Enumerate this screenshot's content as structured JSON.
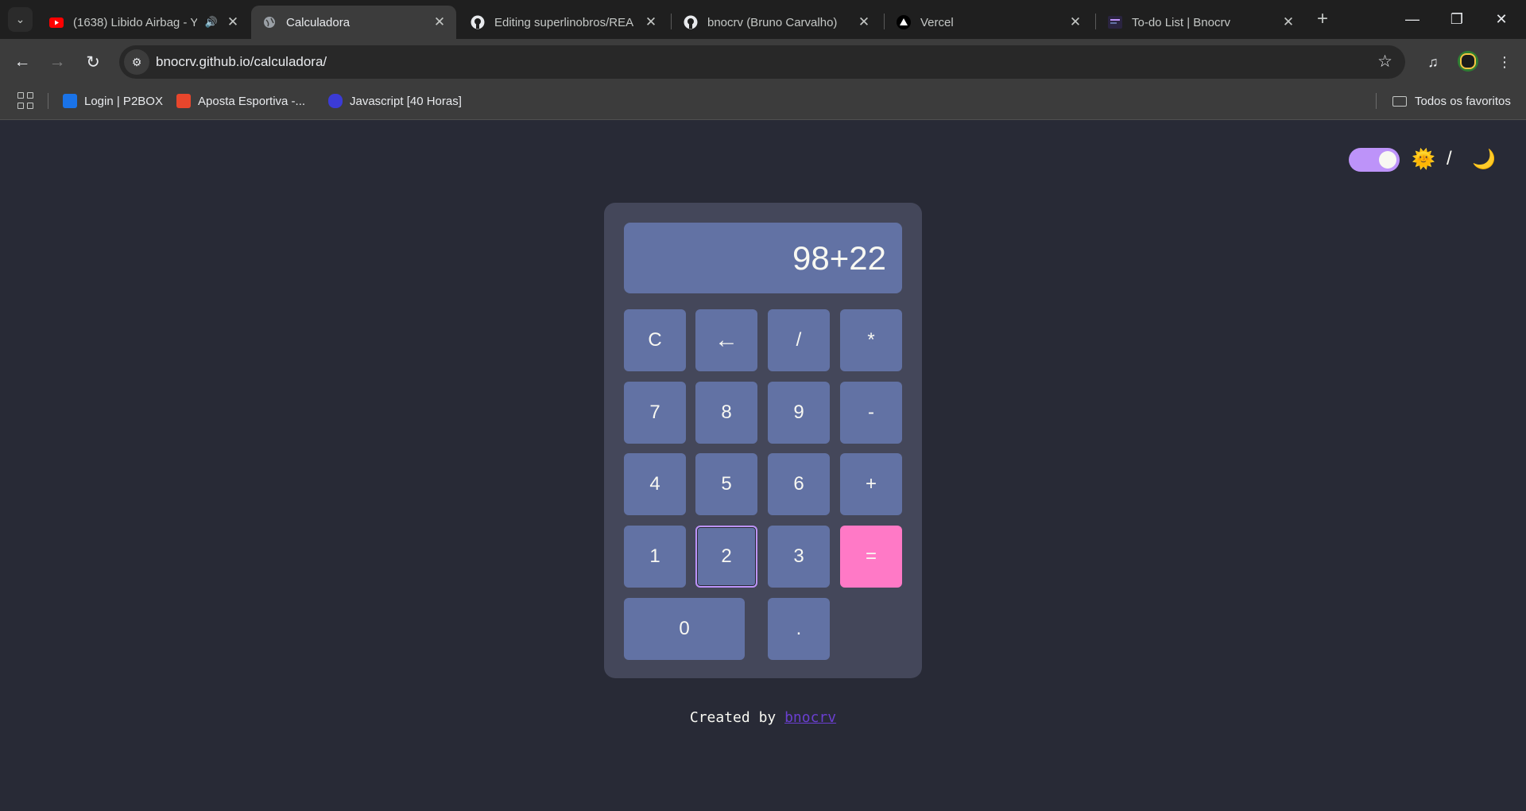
{
  "browser": {
    "tabs": [
      {
        "title": "(1638) Libido Airbag - Y",
        "favicon": "youtube-icon",
        "audio": true,
        "active": false
      },
      {
        "title": "Calculadora",
        "favicon": "globe-icon",
        "audio": false,
        "active": true
      },
      {
        "title": "Editing superlinobros/REA",
        "favicon": "github-icon",
        "audio": false,
        "active": false
      },
      {
        "title": "bnocrv (Bruno Carvalho)",
        "favicon": "github-icon",
        "audio": false,
        "active": false
      },
      {
        "title": "Vercel",
        "favicon": "vercel-icon",
        "audio": false,
        "active": false
      },
      {
        "title": "To-do List | Bnocrv",
        "favicon": "todo-icon",
        "audio": false,
        "active": false
      }
    ],
    "url": "bnocrv.github.io/calculadora/",
    "bookmarks": [
      {
        "label": "Login | P2BOX",
        "favicon_color": "#1a73e8"
      },
      {
        "label": "Aposta Esportiva -...",
        "favicon_color": "#e8462c"
      },
      {
        "label": "Javascript [40 Horas]",
        "favicon_color": "#3b3bd6"
      }
    ],
    "all_bookmarks_label": "Todos os favoritos"
  },
  "theme_toggle": {
    "on": true,
    "sun": "🌞",
    "slash": "/",
    "moon": "🌙"
  },
  "calculator": {
    "display": "98+22",
    "keys": {
      "clear": "C",
      "backspace": "←",
      "divide": "/",
      "multiply": "*",
      "seven": "7",
      "eight": "8",
      "nine": "9",
      "minus": "-",
      "four": "4",
      "five": "5",
      "six": "6",
      "plus": "+",
      "one": "1",
      "two": "2",
      "three": "3",
      "equals": "=",
      "zero": "0",
      "dot": "."
    }
  },
  "footer": {
    "prefix": "Created by",
    "author": "bnocrv"
  },
  "colors": {
    "background": "#282a36",
    "panel": "#44475a",
    "key": "#6272a4",
    "equals": "#ff79c6",
    "accent": "#bd93f9"
  }
}
